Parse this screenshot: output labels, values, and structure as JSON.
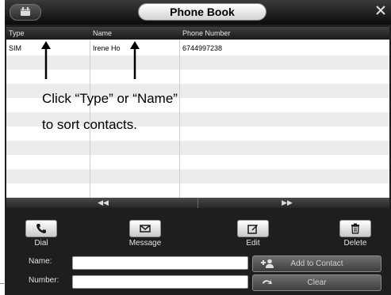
{
  "window": {
    "title": "Phone Book"
  },
  "table": {
    "columns": [
      "Type",
      "Name",
      "Phone Number"
    ],
    "rows": [
      {
        "type": "SIM",
        "name": "Irene Ho",
        "phone": "6744997238"
      }
    ]
  },
  "actions": {
    "dial": "Dial",
    "message": "Message",
    "edit": "Edit",
    "delete": "Delete"
  },
  "form": {
    "name_label": "Name:",
    "name_value": "",
    "number_label": "Number:",
    "number_value": "",
    "add_to_contact": "Add to Contact",
    "clear": "Clear"
  },
  "annotation": {
    "line1": "Click “Type” or “Name”",
    "line2": "to sort contacts."
  },
  "icons": {
    "calendar": "calendar-icon",
    "close": "close-icon",
    "prev": "double-left-arrow-icon",
    "next": "double-right-arrow-icon",
    "dial": "phone-icon",
    "message": "envelope-icon",
    "edit": "edit-icon",
    "delete": "trash-icon",
    "add": "add-contact-icon",
    "clear": "undo-icon"
  }
}
